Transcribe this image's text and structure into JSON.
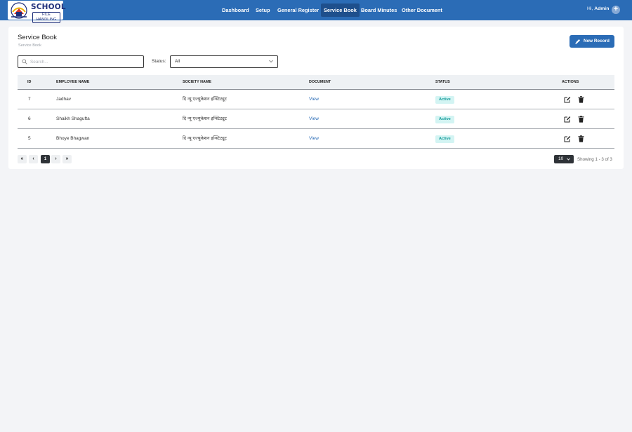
{
  "brand": {
    "name": "SCHOOL",
    "tagline": "FILE HANDLING"
  },
  "nav": [
    {
      "label": "Dashboard",
      "active": false
    },
    {
      "label": "Setup",
      "active": false
    },
    {
      "label": "General Register",
      "active": false
    },
    {
      "label": "Service Book",
      "active": true
    },
    {
      "label": "Board Minutes",
      "active": false
    },
    {
      "label": "Other Document",
      "active": false
    }
  ],
  "user": {
    "greeting": "Hi,",
    "name": "Admin",
    "add_icon": "plus-circle-icon"
  },
  "page": {
    "title": "Service Book",
    "breadcrumb": "Service Book"
  },
  "toolbar": {
    "new_record_label": "New Record",
    "new_record_icon": "pen-icon"
  },
  "filters": {
    "search_placeholder": "Search...",
    "search_value": "",
    "status_label": "Status:",
    "status_selected": "All"
  },
  "table": {
    "headers": {
      "id": "ID",
      "employee": "EMPLOYEE NAME",
      "society": "SOCIETY NAME",
      "document": "DOCUMENT",
      "status": "STATUS",
      "actions": "ACTIONS"
    },
    "rows": [
      {
        "id": "7",
        "employee": "Jadhav",
        "society": "दि न्यू एज्युकेशन इन्स्टिट्यूट",
        "document": "View",
        "status": "Active"
      },
      {
        "id": "6",
        "employee": "Shaikh Shagufta",
        "society": "दि न्यू एज्युकेशन इन्स्टिट्यूट",
        "document": "View",
        "status": "Active"
      },
      {
        "id": "5",
        "employee": "Bhoye Bhagwan",
        "society": "दि न्यू एज्युकेशन इन्स्टिट्यूट",
        "document": "View",
        "status": "Active"
      }
    ]
  },
  "pagination": {
    "first": "«",
    "prev": "‹",
    "current_page": "1",
    "next": "›",
    "last": "»",
    "per_page": "10",
    "summary": "Showing 1 - 3 of 3"
  },
  "colors": {
    "primary": "#2b6cb6",
    "active_badge_bg": "#d3f4f3",
    "active_badge_text": "#139a99"
  }
}
